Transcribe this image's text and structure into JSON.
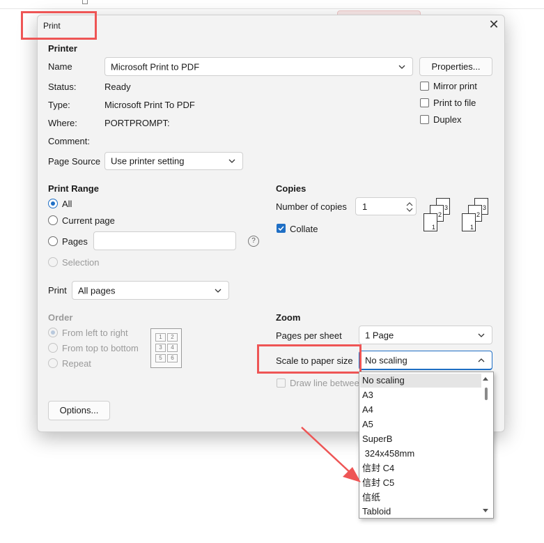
{
  "dialog": {
    "title": "Print",
    "close_glyph": "✕"
  },
  "printer": {
    "heading": "Printer",
    "name_label": "Name",
    "name_value": "Microsoft Print to PDF",
    "properties_label": "Properties...",
    "status_label": "Status:",
    "status_value": "Ready",
    "type_label": "Type:",
    "type_value": "Microsoft Print To PDF",
    "where_label": "Where:",
    "where_value": "PORTPROMPT:",
    "comment_label": "Comment:",
    "page_source_label": "Page Source",
    "page_source_value": "Use printer setting",
    "mirror_print": "Mirror print",
    "print_to_file": "Print to file",
    "duplex": "Duplex"
  },
  "print_range": {
    "heading": "Print Range",
    "all": "All",
    "current_page": "Current page",
    "pages": "Pages",
    "pages_value": "",
    "help_glyph": "?",
    "selection": "Selection",
    "print_label": "Print",
    "print_value": "All pages"
  },
  "copies": {
    "heading": "Copies",
    "number_label": "Number of copies",
    "number_value": "1",
    "collate": "Collate",
    "collate_pages_a": [
      "3",
      "2",
      "1"
    ],
    "collate_pages_b": [
      "3",
      "2",
      "1"
    ]
  },
  "order": {
    "heading": "Order",
    "left_to_right": "From left to right",
    "top_to_bottom": "From top to bottom",
    "repeat": "Repeat",
    "grid": [
      "1",
      "2",
      "3",
      "4",
      "5",
      "6"
    ]
  },
  "zoom": {
    "heading": "Zoom",
    "pages_per_sheet_label": "Pages per sheet",
    "pages_per_sheet_value": "1 Page",
    "scale_label": "Scale to paper size",
    "scale_value": "No scaling",
    "draw_line": "Draw line betwee"
  },
  "options_label": "Options...",
  "scale_options": [
    "No scaling",
    "A3",
    "A4",
    "A5",
    "SuperB",
    " 324x458mm",
    "信封 C4",
    "信封 C5",
    "信纸",
    "Tabloid"
  ],
  "colors": {
    "accent": "#1f6fc5",
    "highlight": "#ee5555"
  }
}
